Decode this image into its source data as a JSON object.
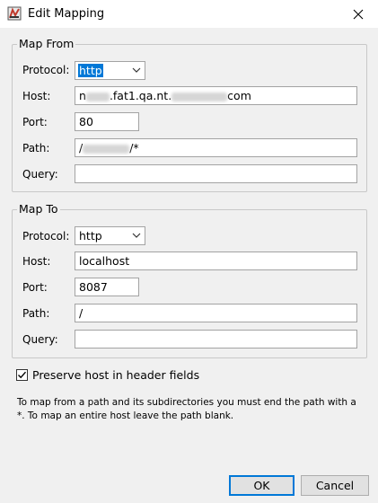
{
  "window": {
    "title": "Edit Mapping",
    "close_icon": "close-icon",
    "app_icon": "charles-app-icon"
  },
  "map_from": {
    "legend": "Map From",
    "protocol_label": "Protocol:",
    "protocol_value": "http",
    "host_label": "Host:",
    "host_value_start": "n",
    "host_value_mid": ".fat1.qa.nt.",
    "host_value_end": "com",
    "port_label": "Port:",
    "port_value": "80",
    "path_label": "Path:",
    "path_value_start": "/",
    "path_value_end": "/*",
    "query_label": "Query:",
    "query_value": ""
  },
  "map_to": {
    "legend": "Map To",
    "protocol_label": "Protocol:",
    "protocol_value": "http",
    "host_label": "Host:",
    "host_value": "localhost",
    "port_label": "Port:",
    "port_value": "8087",
    "path_label": "Path:",
    "path_value": "/",
    "query_label": "Query:",
    "query_value": ""
  },
  "preserve_host": {
    "label": "Preserve host in header fields",
    "checked": true
  },
  "help_text": "To map from a path and its subdirectories you must end the path with a *. To map an entire host leave the path blank.",
  "buttons": {
    "ok": "OK",
    "cancel": "Cancel"
  },
  "colors": {
    "selection": "#0078d7",
    "dialog_bg": "#f0f0f0",
    "default_button_border": "#0078d7"
  }
}
